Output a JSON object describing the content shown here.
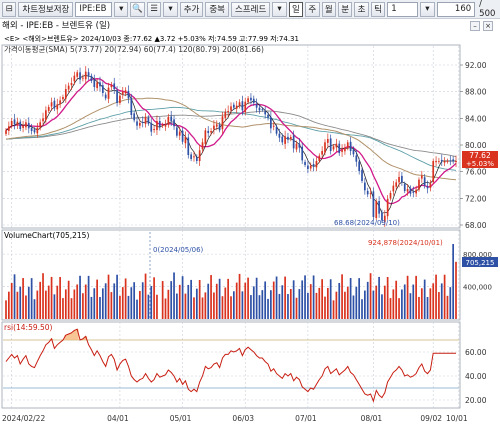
{
  "toolbar": {
    "buttons": [
      "⊟",
      "차트정보저장",
      "IPE:EB",
      "▾",
      "🔍",
      "☰",
      "▾",
      "추가",
      "중복",
      "스프레드",
      "▾",
      "일",
      "주",
      "월",
      "분",
      "초",
      "틱",
      "1",
      "▾",
      "160",
      "/ 500"
    ],
    "chart_kind": "IPE:EB",
    "period": "1",
    "count": "160",
    "total": "/ 500"
  },
  "title": "해외 - IPE:EB - 브렌트유 (일)",
  "price_panel": {
    "info_line": "<E> <해외>브렌트유> 2024/10/03 종:77.62 ▲3.72 +5.03% 저:74.59 고:77.99 저:74.31",
    "ma_label": "가격이동평균(SMA) 5(73.77) 20(72.94) 60(77.4) 120(80.79) 200(81.66)",
    "y_ticks": [
      "92.00",
      "88.00",
      "84.00",
      "80.00",
      "76.00",
      "72.00",
      "68.00"
    ],
    "last_price_tag": "77.62",
    "last_change_tag": "+5.03%",
    "low_annotation": "68.68(2024/09/10)",
    "ma_colors": {
      "sma5": "#1a1a1a",
      "sma20": "#d1198a",
      "sma60": "#b0926a",
      "sma120": "#5ea0a8",
      "sma200": "#8a8a8a"
    },
    "up_color": "#d9331f",
    "down_color": "#2e51a6"
  },
  "volume_panel": {
    "label": "VolumeChart(705,215)",
    "y_ticks": [
      "800,000",
      "400,000"
    ],
    "min_annotation": "0(2024/05/06)",
    "max_annotation": "924,878(2024/10/01)",
    "last_tag": "705,215"
  },
  "rsi_panel": {
    "label": "rsi(14:59.50)",
    "y_ticks": [
      "60.00",
      "40.00",
      "20.00"
    ],
    "upper_band": 70,
    "lower_band": 30,
    "line_color": "#c81e12"
  },
  "x_axis": {
    "labels": [
      "2024/02/22",
      "04/01",
      "05/01",
      "06/03",
      "07/01",
      "08/01",
      "09/02",
      "10/01"
    ],
    "positions": [
      2,
      40,
      62,
      84,
      106,
      129,
      150,
      159
    ]
  },
  "chart_data": {
    "type": "candlestick",
    "dates_first": "2024/02/22",
    "dates_last": "2024/10/03",
    "close": [
      82.2,
      82.8,
      83.6,
      83.1,
      83.5,
      82.4,
      82.9,
      83.4,
      82.5,
      82.1,
      81.9,
      82.6,
      83.4,
      84.0,
      85.2,
      85.7,
      86.4,
      85.5,
      86.1,
      86.7,
      87.2,
      88.4,
      88.9,
      89.3,
      90.4,
      90.9,
      89.8,
      90.1,
      91.0,
      90.3,
      89.6,
      88.7,
      89.4,
      88.8,
      87.8,
      87.0,
      88.6,
      89.0,
      88.4,
      86.3,
      87.4,
      88.0,
      88.2,
      87.0,
      84.5,
      83.7,
      82.9,
      83.3,
      83.4,
      84.2,
      83.2,
      82.0,
      82.4,
      83.6,
      82.7,
      83.0,
      83.1,
      84.2,
      83.6,
      82.8,
      81.4,
      82.0,
      80.5,
      81.2,
      78.5,
      77.9,
      78.3,
      77.6,
      79.2,
      80.4,
      82.2,
      81.8,
      82.1,
      82.9,
      83.1,
      82.2,
      84.3,
      85.0,
      85.1,
      85.8,
      85.6,
      85.9,
      86.4,
      85.2,
      86.5,
      87.0,
      86.7,
      86.3,
      85.6,
      85.2,
      85.3,
      84.6,
      84.1,
      82.5,
      82.9,
      81.7,
      81.1,
      80.4,
      81.3,
      80.8,
      81.2,
      79.5,
      80.2,
      79.6,
      77.7,
      77.0,
      76.4,
      76.9,
      76.8,
      77.6,
      78.4,
      79.1,
      80.4,
      80.9,
      79.1,
      79.8,
      80.2,
      78.8,
      79.3,
      79.6,
      80.4,
      79.1,
      78.6,
      77.5,
      76.1,
      74.6,
      73.2,
      72.6,
      72.8,
      69.2,
      71.6,
      69.7,
      68.7,
      69.4,
      71.9,
      72.8,
      73.9,
      74.4,
      75.2,
      74.4,
      73.1,
      73.4,
      72.7,
      72.9,
      73.3,
      74.8,
      75.4,
      73.9,
      73.5,
      74.2,
      77.6,
      77.6,
      77.6,
      77.6,
      77.6,
      77.6,
      77.6,
      77.6,
      77.6
    ],
    "rsi": [
      52,
      55,
      58,
      55,
      57,
      50,
      54,
      57,
      50,
      48,
      47,
      52,
      57,
      61,
      66,
      68,
      71,
      63,
      66,
      68,
      70,
      74,
      75,
      76,
      78,
      79,
      70,
      71,
      73,
      66,
      62,
      57,
      61,
      57,
      52,
      48,
      56,
      58,
      54,
      45,
      50,
      53,
      54,
      48,
      40,
      37,
      35,
      37,
      38,
      42,
      38,
      35,
      37,
      42,
      39,
      40,
      41,
      45,
      43,
      40,
      35,
      38,
      33,
      36,
      29,
      27,
      29,
      27,
      35,
      40,
      48,
      46,
      47,
      50,
      51,
      47,
      55,
      58,
      58,
      61,
      60,
      61,
      63,
      57,
      62,
      64,
      62,
      60,
      57,
      55,
      55,
      52,
      50,
      44,
      46,
      42,
      40,
      38,
      42,
      40,
      42,
      36,
      39,
      37,
      31,
      29,
      27,
      30,
      29,
      33,
      37,
      40,
      46,
      48,
      42,
      44,
      46,
      41,
      43,
      45,
      48,
      43,
      41,
      37,
      33,
      29,
      25,
      24,
      25,
      19,
      28,
      24,
      22,
      26,
      35,
      39,
      43,
      45,
      48,
      45,
      40,
      41,
      39,
      40,
      42,
      47,
      50,
      44,
      42,
      45,
      59,
      59,
      59,
      59,
      59,
      59,
      59,
      59,
      59
    ]
  }
}
